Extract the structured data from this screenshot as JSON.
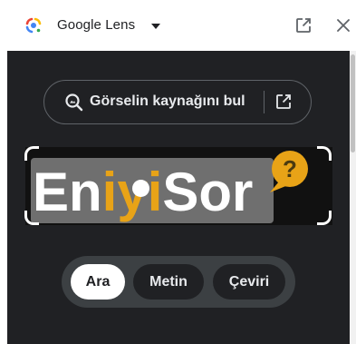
{
  "header": {
    "title": "Google Lens",
    "icons": {
      "logo": "google-lens-logo",
      "dropdown": "caret-down-icon",
      "open_external": "open-in-new-icon",
      "close": "close-icon"
    }
  },
  "source_button": {
    "label": "Görselin kaynağını bul",
    "icons": [
      "image-search-icon",
      "open-in-new-icon"
    ]
  },
  "image": {
    "logo_text_parts": [
      "En",
      "iyi",
      "Sor"
    ],
    "badge_symbol": "?",
    "colors": {
      "text": "#ffffff",
      "accent": "#e8a317",
      "plate": "#6f6f6f",
      "background": "#111111"
    }
  },
  "mode_tabs": [
    {
      "label": "Ara",
      "selected": true
    },
    {
      "label": "Metin",
      "selected": false
    },
    {
      "label": "Çeviri",
      "selected": false
    }
  ],
  "theme": {
    "panel_bg": "#202124",
    "tab_group_bg": "#3c4043",
    "selected_tab_bg": "#ffffff",
    "text_light": "#e8eaed"
  }
}
